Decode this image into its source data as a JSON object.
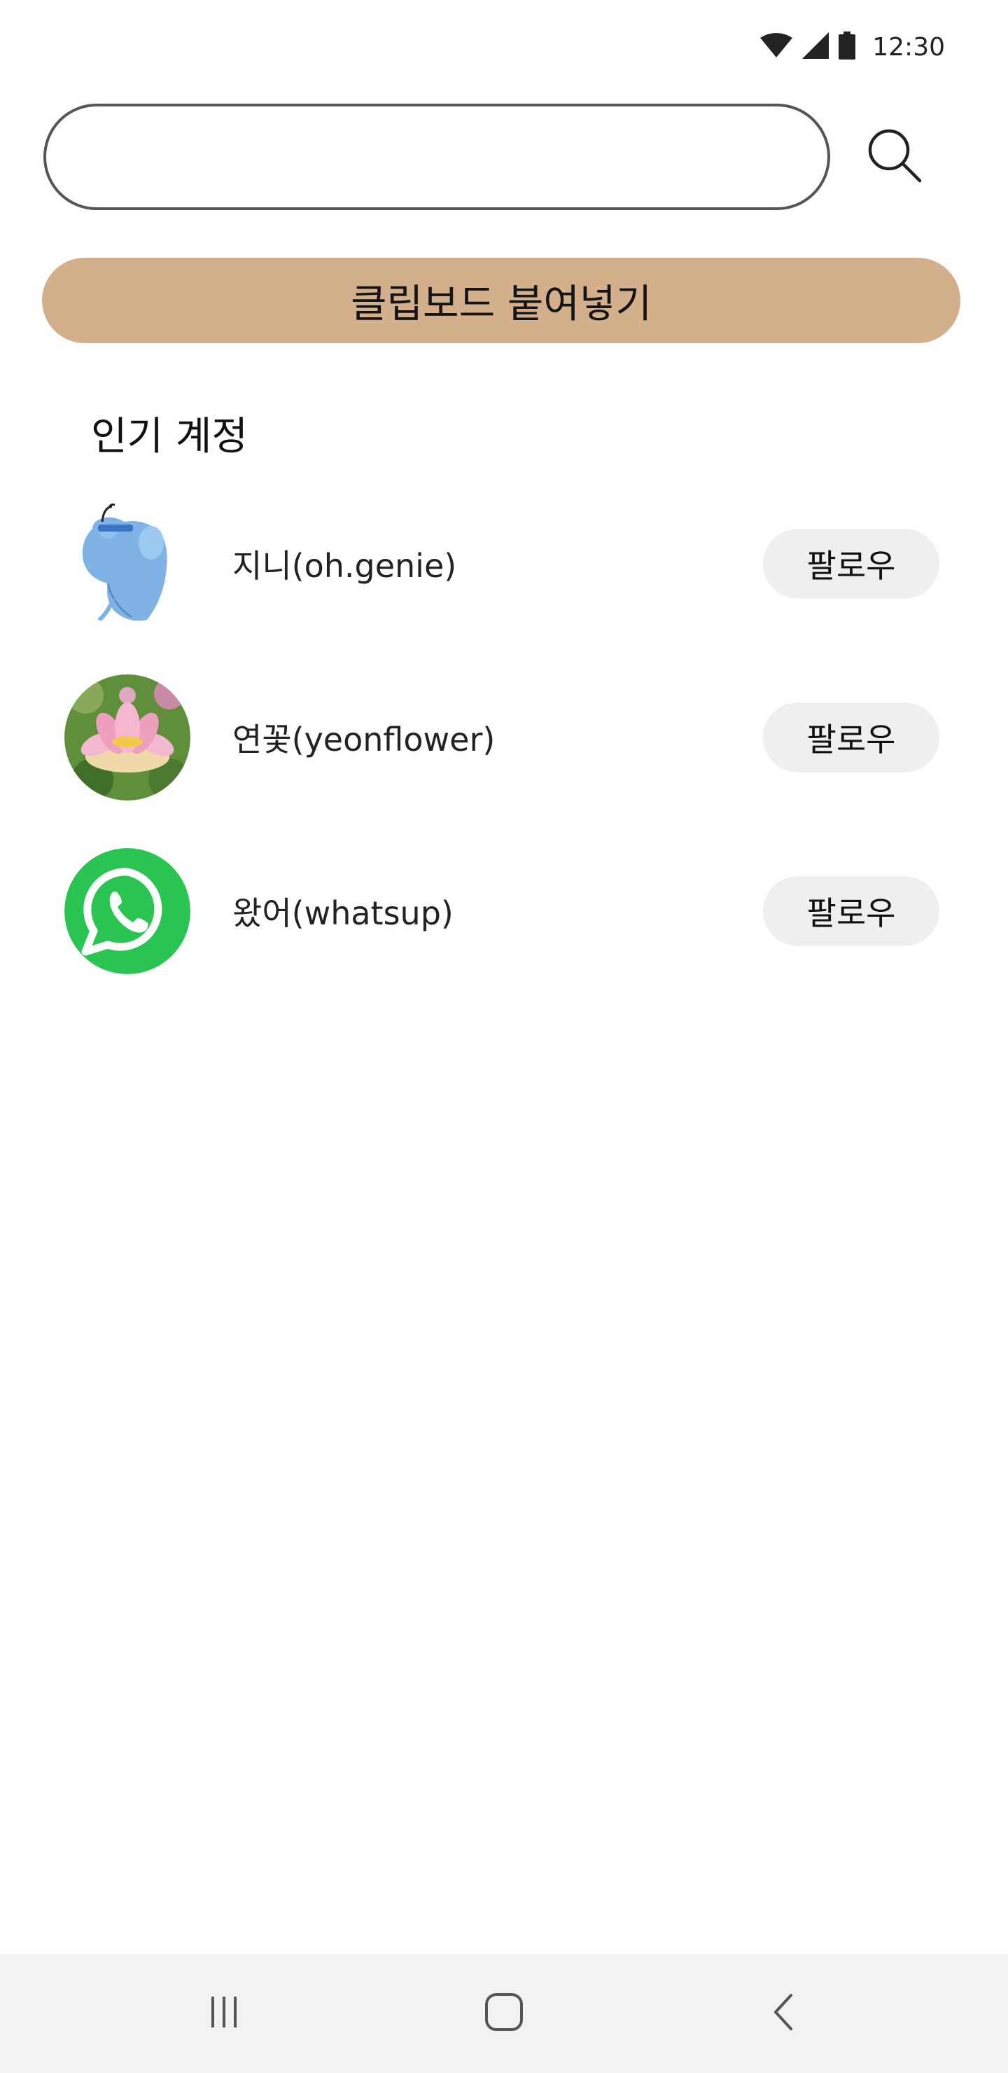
{
  "status_bar": {
    "time": "12:30",
    "icons": [
      "wifi-icon",
      "signal-icon",
      "battery-icon"
    ]
  },
  "search": {
    "value": "",
    "placeholder": "",
    "icon": "search-icon"
  },
  "paste_button": {
    "label": "클립보드 붙여넣기",
    "color": "#d4af8c"
  },
  "popular": {
    "title": "인기 계정",
    "accounts": [
      {
        "name": "지니(oh.genie)",
        "avatar": "genie-avatar",
        "follow_label": "팔로우"
      },
      {
        "name": "연꽃(yeonflower)",
        "avatar": "lotus-avatar",
        "follow_label": "팔로우"
      },
      {
        "name": "왔어(whatsup)",
        "avatar": "whatsapp-avatar",
        "follow_label": "팔로우"
      }
    ]
  },
  "nav": {
    "buttons": [
      "recent-apps-icon",
      "home-icon",
      "back-icon"
    ]
  }
}
